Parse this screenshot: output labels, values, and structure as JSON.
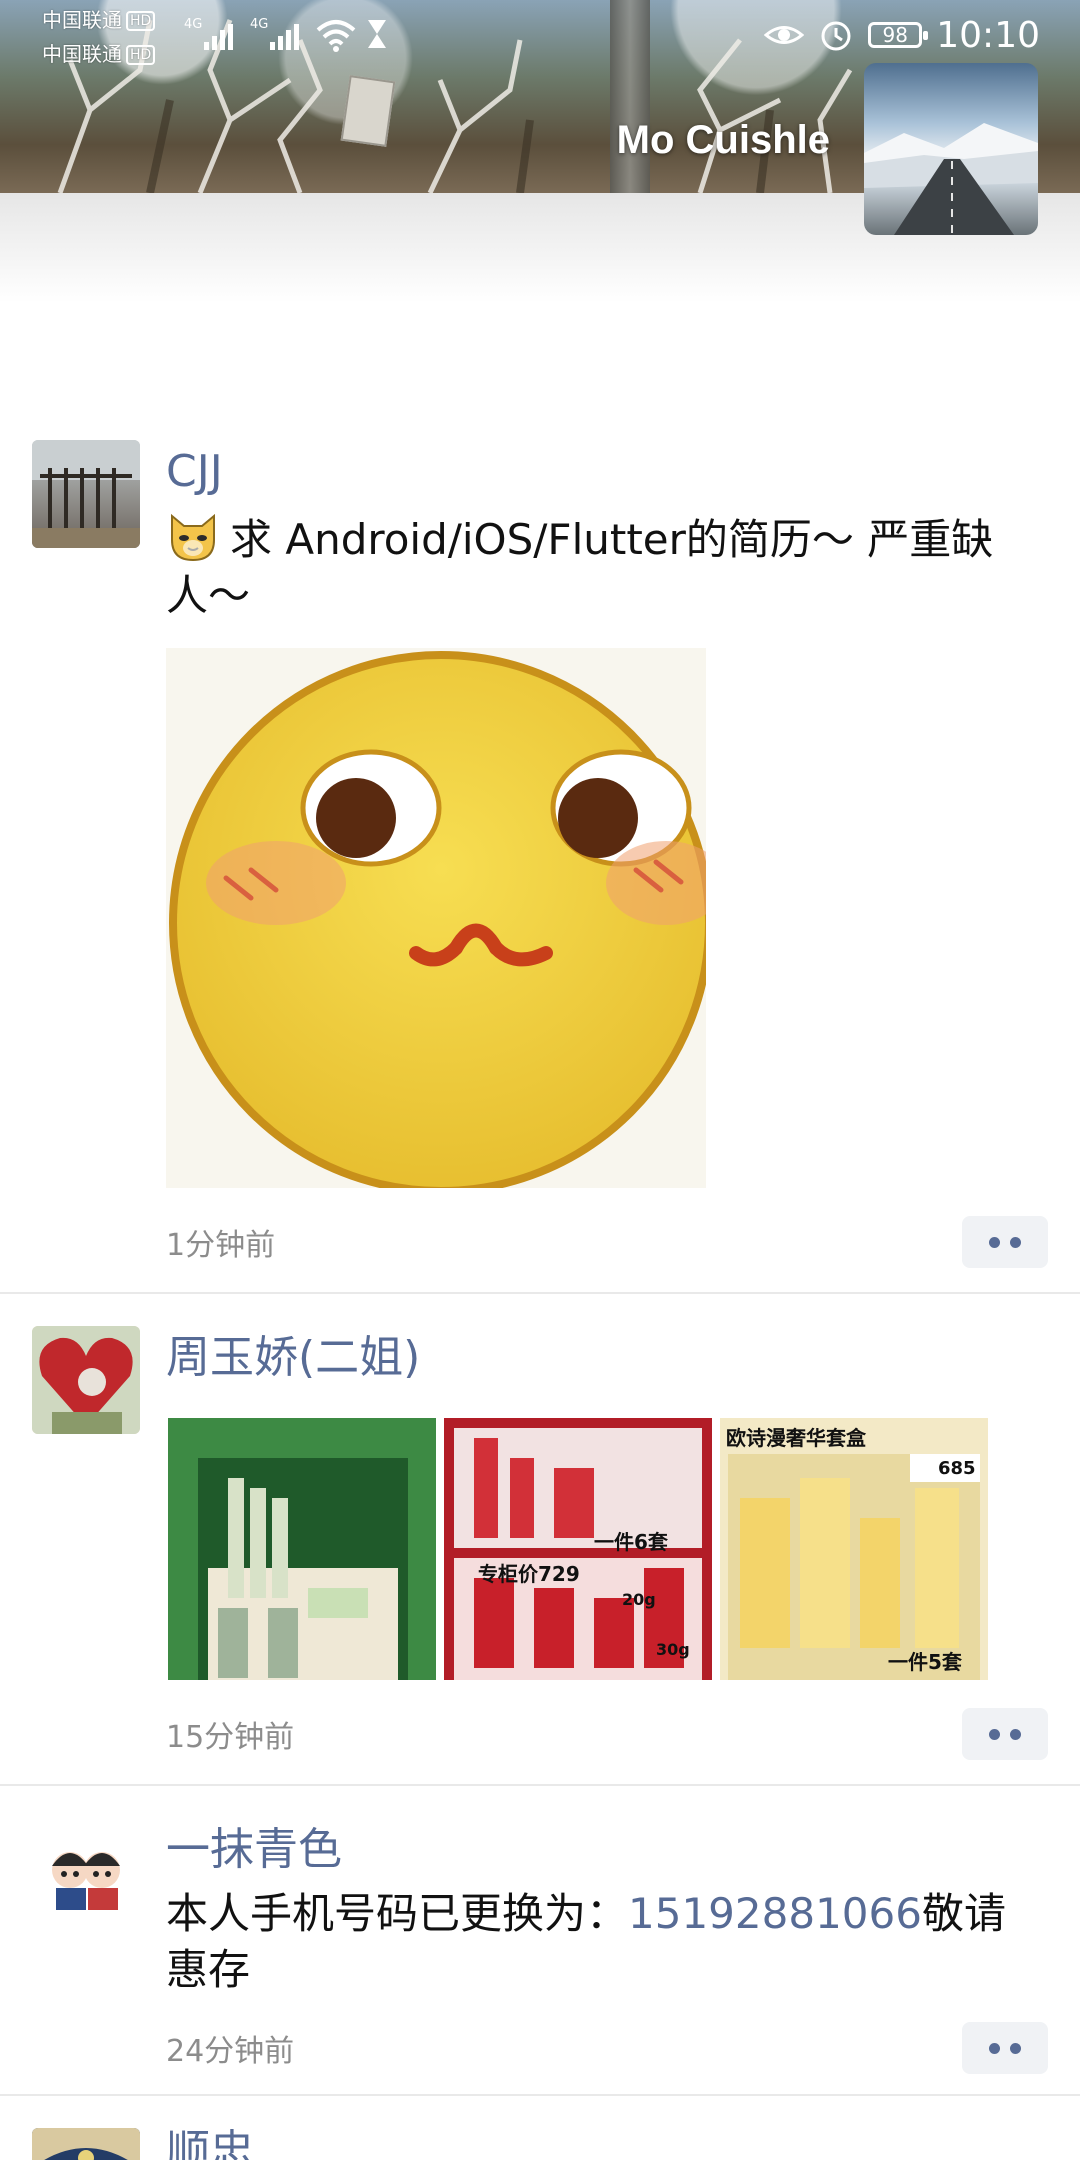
{
  "status_bar": {
    "carrier_1": "中国联通",
    "carrier_2": "中国联通",
    "hd": "HD",
    "network": "4G",
    "battery": "98",
    "time": "10:10"
  },
  "profile": {
    "name": "Mo Cuishle"
  },
  "posts": [
    {
      "author": "CJJ",
      "text": "求 Android/iOS/Flutter的简历～ 严重缺人～",
      "time": "1分钟前"
    },
    {
      "author": "周玉娇(二姐)",
      "images": [
        {
          "caption": ""
        },
        {
          "caption_top": "专柜价729",
          "caption_bottom": "一件6套",
          "weight_1": "20g",
          "weight_2": "30g"
        },
        {
          "caption_top": "欧诗漫奢华套盒",
          "badge": "685",
          "caption_bottom": "一件5套"
        }
      ],
      "time": "15分钟前"
    },
    {
      "author": "一抹青色",
      "text_before": "本人手机号码已更换为：",
      "phone": "15192881066",
      "text_after": "敬请惠存",
      "time": "24分钟前"
    },
    {
      "author": "顺忠"
    }
  ],
  "colors": {
    "link": "#576b95",
    "timestamp": "#8c8c8c",
    "divider": "#e9e9e9"
  }
}
